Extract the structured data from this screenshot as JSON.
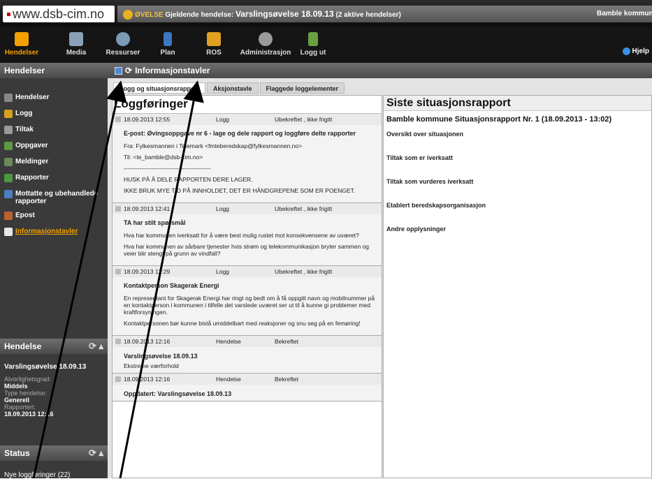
{
  "top": {
    "site": "www.dsb-cim.no",
    "banner_prefix": "ØVELSE",
    "banner_label": "Gjeldende hendelse:",
    "banner_event": "Varslingsøvelse 18.09.13",
    "banner_count": "(2 aktive hendelser)",
    "municipality": "Bamble kommun"
  },
  "nav": {
    "items": [
      {
        "label": "Hendelser",
        "icon": "radar-icon",
        "color": "#f4a000"
      },
      {
        "label": "Media",
        "icon": "media-icon",
        "color": "#8aa0b8"
      },
      {
        "label": "Ressurser",
        "icon": "globe-icon",
        "color": "#7a9ab5"
      },
      {
        "label": "Plan",
        "icon": "document-icon",
        "color": "#3a78c0"
      },
      {
        "label": "ROS",
        "icon": "cube-icon",
        "color": "#e0a020"
      },
      {
        "label": "Administrasjon",
        "icon": "gear-icon",
        "color": "#9a9a9a"
      },
      {
        "label": "Logg ut",
        "icon": "logout-icon",
        "color": "#6aa040"
      }
    ],
    "help": "Hjelp"
  },
  "sidebar": {
    "title": "Hendelser",
    "items": [
      {
        "label": "Hendelser",
        "icon": "events-icon",
        "color": "#888888"
      },
      {
        "label": "Logg",
        "icon": "log-icon",
        "color": "#d4a020"
      },
      {
        "label": "Tiltak",
        "icon": "measures-icon",
        "color": "#9a9a9a"
      },
      {
        "label": "Oppgaver",
        "icon": "tasks-icon",
        "color": "#5a9a40"
      },
      {
        "label": "Meldinger",
        "icon": "messages-icon",
        "color": "#6a8a5a"
      },
      {
        "label": "Rapporter",
        "icon": "reports-icon",
        "color": "#4a9a40"
      },
      {
        "label": "Mottatte og ubehandlede rapporter",
        "icon": "inbox-icon",
        "color": "#4a80c0"
      },
      {
        "label": "Epost",
        "icon": "email-icon",
        "color": "#c06030"
      },
      {
        "label": "Informasjonstavler",
        "icon": "board-icon",
        "color": "#e8e8e8"
      }
    ]
  },
  "hendelse_panel": {
    "title": "Hendelse",
    "event_name": "Varslingsøvelse 18.09.13",
    "severity_label": "Alvorlighetsgrad:",
    "severity_value": "Middels",
    "type_label": "Type hendelse:",
    "type_value": "Generell",
    "reported_label": "Rapportert:",
    "reported_value": "18.09.2013 12:16"
  },
  "status_panel": {
    "title": "Status",
    "new_entries": "Nye loggføringer (22)"
  },
  "main": {
    "header": "Informasjonstavler",
    "tabs": [
      "Logg og situasjonsrapport",
      "Aksjonstavle",
      "Flaggede loggelementer"
    ]
  },
  "log": {
    "title": "Loggføringer",
    "entries": [
      {
        "date": "18.09.2013 12:55",
        "type": "Logg",
        "status": "Ubekreftet , ikke frigitt",
        "heading": "E-post: Øvingsoppgave nr 6 - lage og dele rapport og loggføre delte rapporter",
        "lines": [
          "Fra: Fylkesmannen i Telemark <fmteberedskap@fylkesmannen.no>",
          "Til: <te_bamble@dsb-cim.no>",
          "--------------------------------------------",
          "HUSK PÅ Å DELE RAPPORTEN DERE LAGER.",
          "IKKE BRUK MYE TID PÅ INNHOLDET, DET ER HÅNDGREPENE SOM ER POENGET."
        ]
      },
      {
        "date": "18.09.2013 12:41",
        "type": "Logg",
        "status": "Ubekreftet , ikke frigitt",
        "heading": "TA har stilt spørsmål",
        "lines": [
          "Hva har kommunen iverksatt for å være best mulig rustet mot konsekvensene av uværet?",
          "Hva har kommunen av sårbare tjenester hvis strøm og telekommunikasjon bryter sammen og veier blir stengt på grunn av vindfall?"
        ]
      },
      {
        "date": "18.09.2013 12:29",
        "type": "Logg",
        "status": "Ubekreftet , ikke frigitt",
        "heading": "Kontaktperson Skagerak Energi",
        "lines": [
          "En representant for Skagerak Energi har ringt og bedt om å få oppgitt navn og mobilnummer på en kontaktperson i kommunen i tilfelle det varslede uværet ser ut til å kunne gi problemer med kraftforsyningen.",
          "Kontaktpersonen bør kunne bistå umiddelbart med reaksjoner og snu seg på en femøring!"
        ]
      },
      {
        "date": "18.09.2013 12:16",
        "type": "Hendelse",
        "status": "Bekreftet",
        "heading": "Varslingsøvelse 18.09.13",
        "lines": [
          "Ekstreme værforhold"
        ]
      },
      {
        "date": "18.09.2013 12:16",
        "type": "Hendelse",
        "status": "Bekreftet",
        "heading": "Oppdatert: Varslingsøvelse 18.09.13",
        "lines": []
      }
    ]
  },
  "situation": {
    "title": "Siste situasjonsrapport",
    "subtitle": "Bamble kommune Situasjonsrapport Nr. 1 (18.09.2013 - 13:02)",
    "sections": [
      "Oversikt over situasjonen",
      "Tiltak som er iverksatt",
      "Tiltak som vurderes iverksatt",
      "Etablert beredskapsorganisasjon",
      "Andre opplysninger"
    ]
  }
}
